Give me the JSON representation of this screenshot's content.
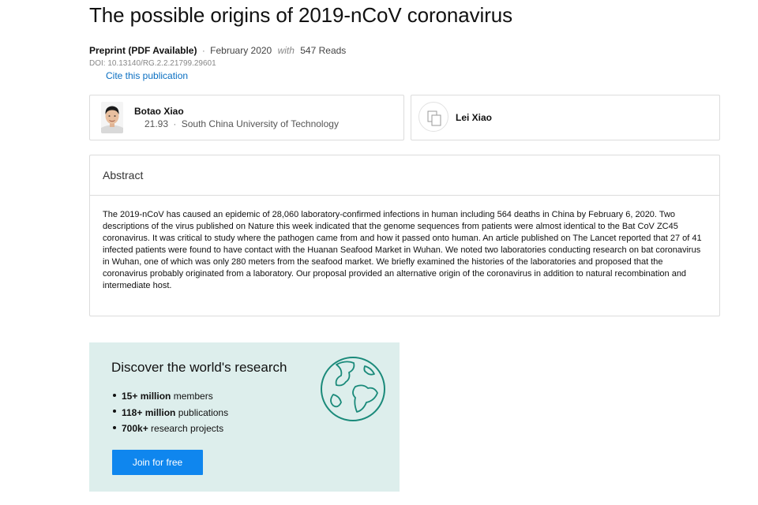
{
  "publication": {
    "title": "The possible origins of 2019-nCoV coronavirus",
    "type": "Preprint (PDF Available)",
    "separator": "·",
    "date": "February 2020",
    "with_word": "with",
    "reads": "547 Reads",
    "doi": "DOI: 10.13140/RG.2.2.21799.29601",
    "cite_label": "Cite this publication"
  },
  "authors": [
    {
      "name": "Botao Xiao",
      "score": "21.93",
      "separator": "·",
      "institution": "South China University of Technology",
      "avatar": "photo"
    },
    {
      "name": "Lei Xiao",
      "avatar": "placeholder-icon"
    }
  ],
  "abstract": {
    "heading": "Abstract",
    "text": "The 2019-nCoV has caused an epidemic of 28,060 laboratory-confirmed infections in human including 564 deaths in China by February 6, 2020. Two descriptions of the virus published on Nature this week indicated that the genome sequences from patients were almost identical to the Bat CoV ZC45 coronavirus. It was critical to study where the pathogen came from and how it passed onto human. An article published on The Lancet reported that 27 of 41 infected patients were found to have contact with the Huanan Seafood Market in Wuhan. We noted two laboratories conducting research on bat coronavirus in Wuhan, one of which was only 280 meters from the seafood market. We briefly examined the histories of the laboratories and proposed that the coronavirus probably originated from a laboratory. Our proposal provided an alternative origin of the coronavirus in addition to natural recombination and intermediate host."
  },
  "discover": {
    "title": "Discover the world's research",
    "items": [
      {
        "bold": "15+ million",
        "rest": " members"
      },
      {
        "bold": "118+ million",
        "rest": " publications"
      },
      {
        "bold": "700k+",
        "rest": " research projects"
      }
    ],
    "join_label": "Join for free",
    "icon": "globe-icon"
  },
  "colors": {
    "link": "#0a6fc2",
    "button": "#0f86ee",
    "discover_bg": "#ddeeec",
    "globe": "#1a8a7a"
  }
}
